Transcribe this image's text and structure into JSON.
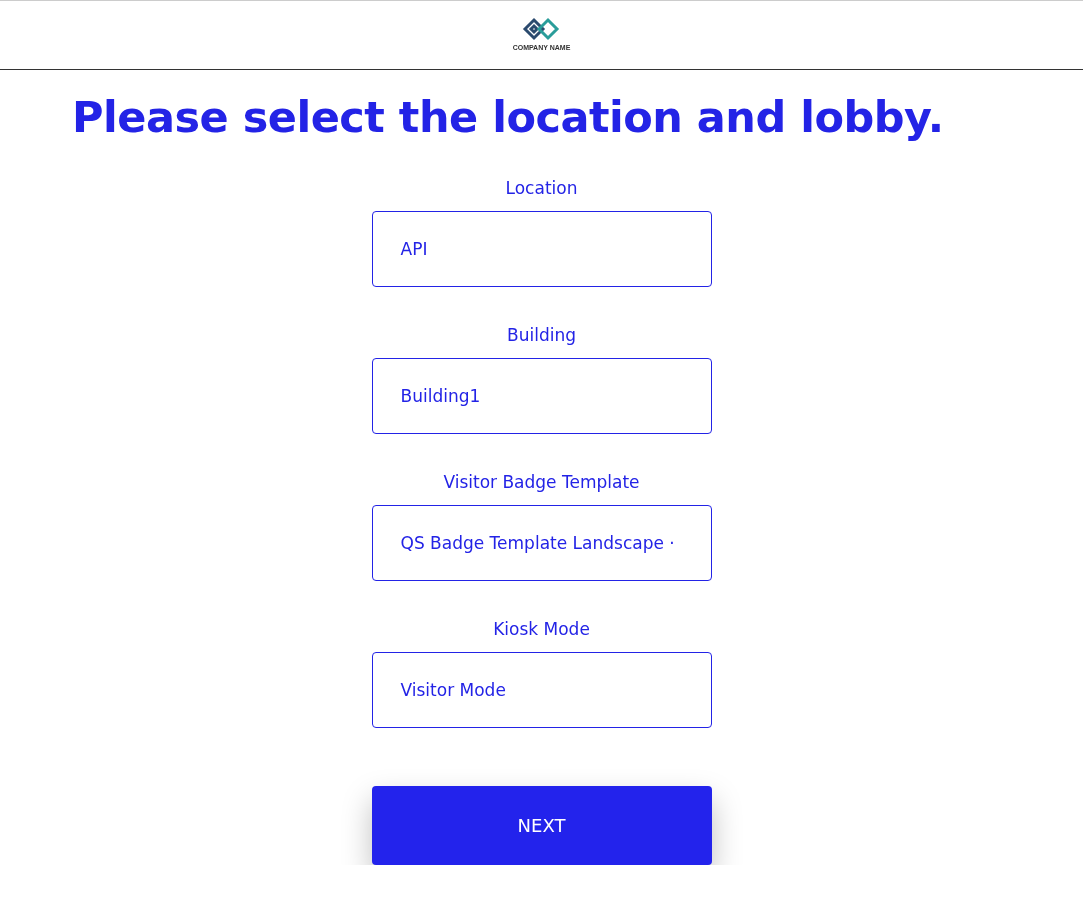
{
  "header": {
    "logo_text": "COMPANY NAME"
  },
  "title": "Please select the location and lobby.",
  "fields": [
    {
      "label": "Location",
      "value": "API"
    },
    {
      "label": "Building",
      "value": "Building1"
    },
    {
      "label": "Visitor Badge Template",
      "value": "QS Badge Template Landscape ·"
    },
    {
      "label": "Kiosk Mode",
      "value": "Visitor Mode"
    }
  ],
  "button": "NEXT"
}
